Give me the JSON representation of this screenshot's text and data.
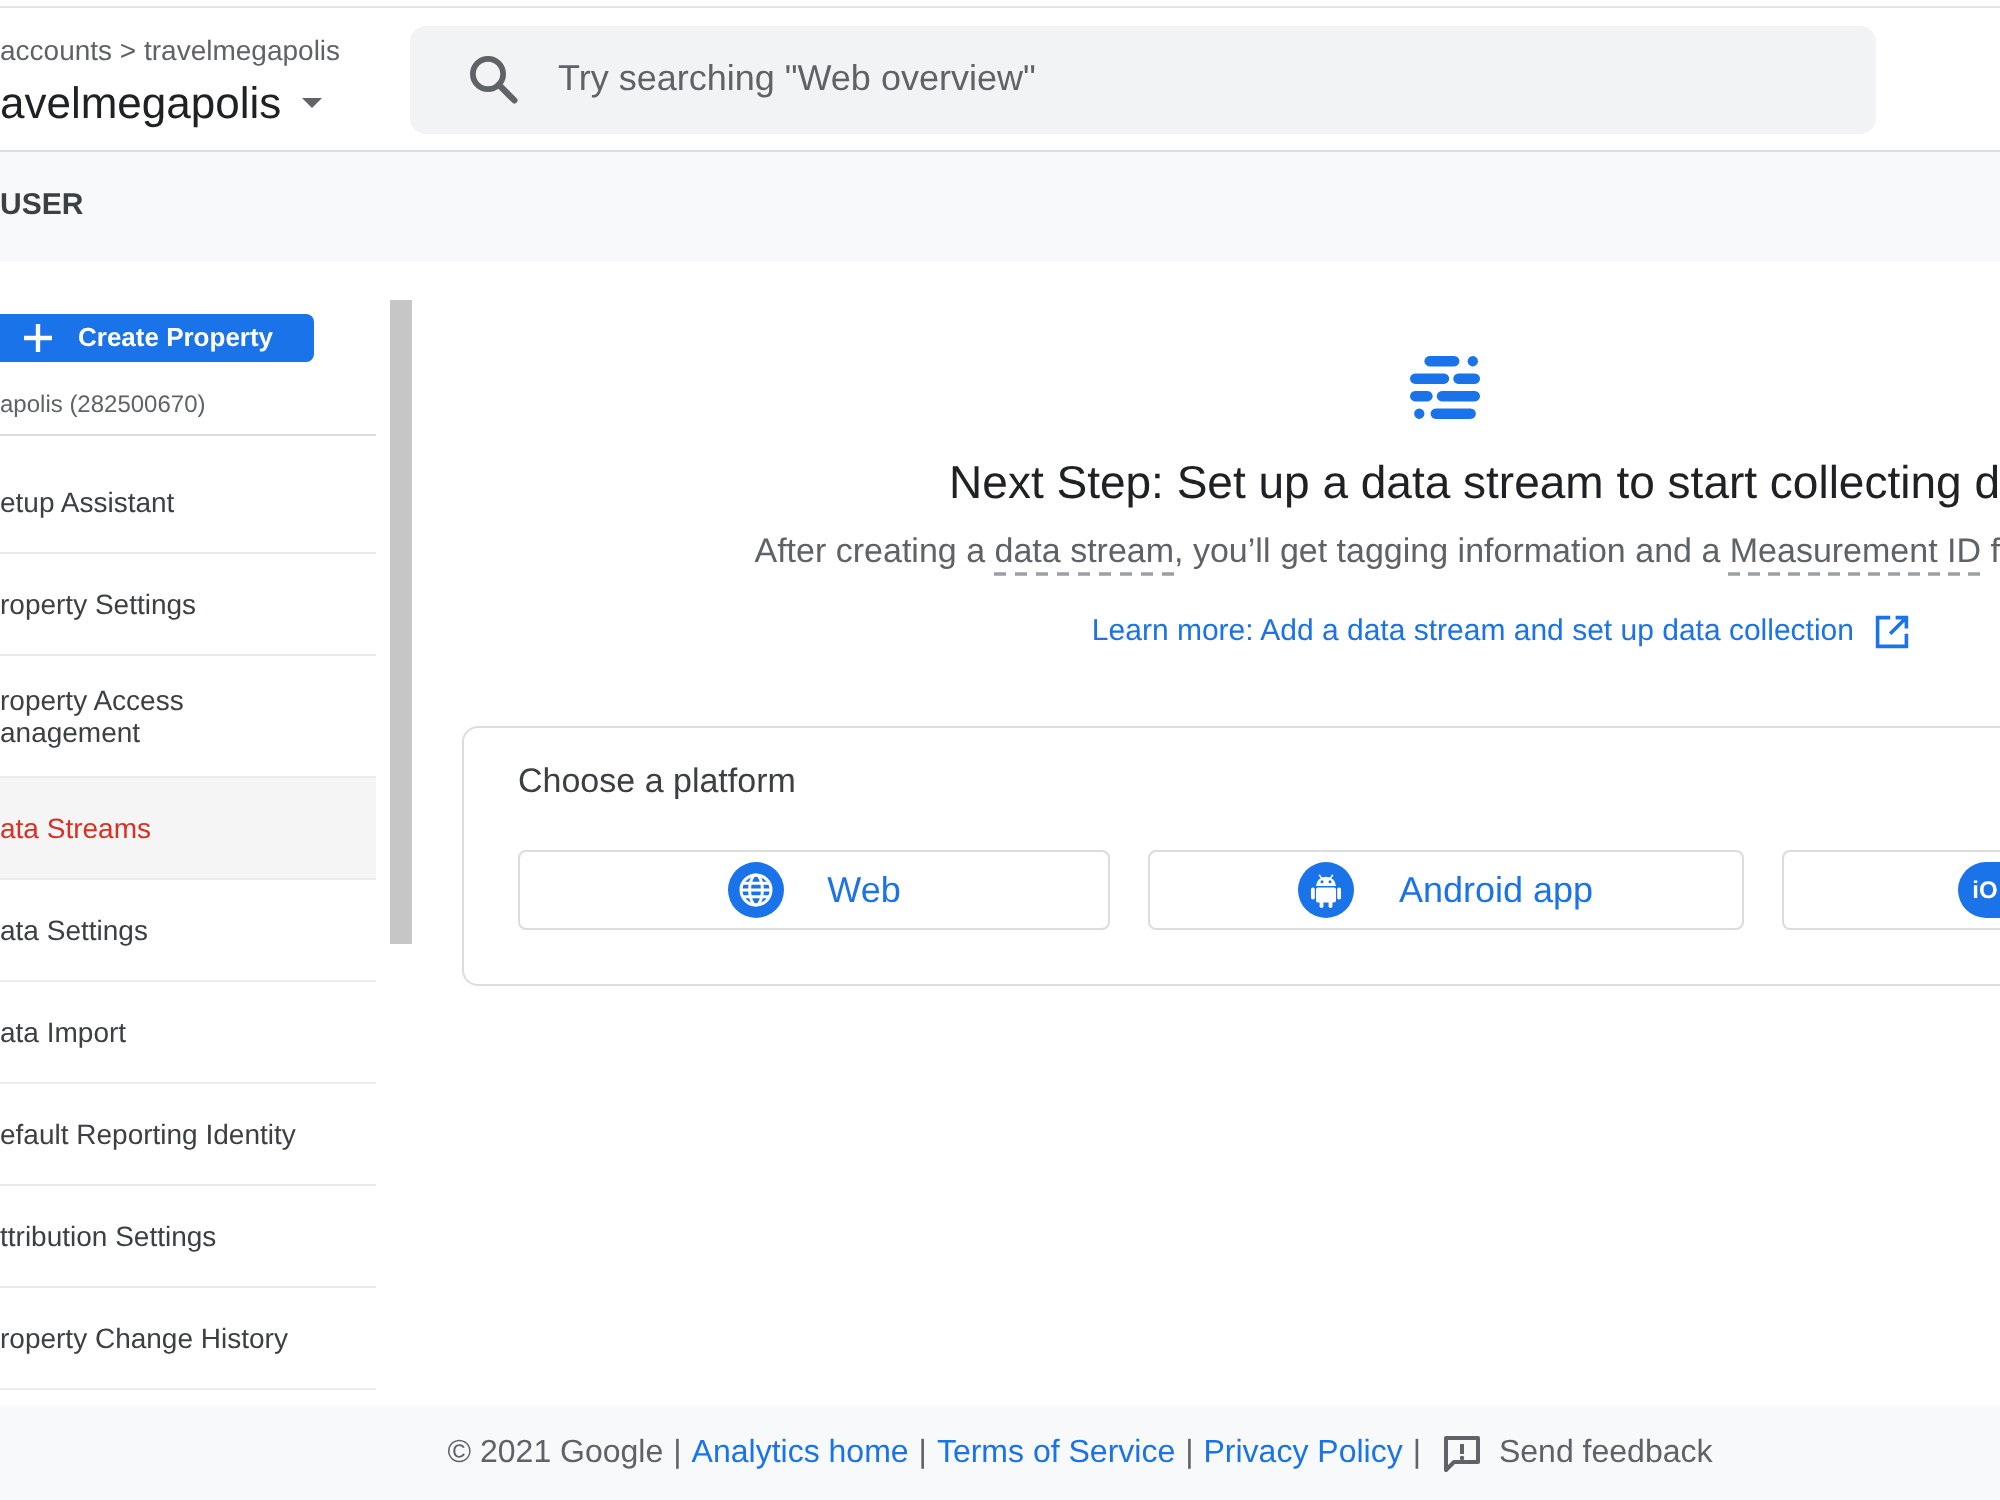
{
  "header": {
    "breadcrumb": "accounts > travelmegapolis",
    "title": "avelmegapolis",
    "search": {
      "placeholder": "Try searching \"Web overview\""
    }
  },
  "section_bar": {
    "label": "USER"
  },
  "sidebar": {
    "create_button": "Create Property",
    "property": "apolis (282500670)",
    "items": [
      {
        "label": "etup Assistant",
        "selected": false
      },
      {
        "label": "roperty Settings",
        "selected": false
      },
      {
        "label": "roperty Access\nanagement",
        "selected": false
      },
      {
        "label": "ata Streams",
        "selected": true
      },
      {
        "label": "ata Settings",
        "selected": false
      },
      {
        "label": "ata Import",
        "selected": false
      },
      {
        "label": "efault Reporting Identity",
        "selected": false
      },
      {
        "label": "ttribution Settings",
        "selected": false
      },
      {
        "label": "roperty Change History",
        "selected": false
      }
    ]
  },
  "main": {
    "heading": "Next Step: Set up a data stream to start collecting d",
    "description": [
      {
        "kind": "text",
        "text": "After creating a "
      },
      {
        "kind": "term",
        "text": "data stream"
      },
      {
        "kind": "text",
        "text": ", you’ll get tagging information and a "
      },
      {
        "kind": "term",
        "text": "Measurement ID"
      },
      {
        "kind": "text",
        "text": " f"
      }
    ],
    "learn_more": "Learn more: Add a data stream and set up data collection",
    "platform_card": {
      "title": "Choose a platform",
      "platforms": [
        {
          "kind": "web",
          "label": "Web"
        },
        {
          "kind": "android",
          "label": "Android app"
        },
        {
          "kind": "ios",
          "logo_text": "iO"
        }
      ]
    }
  },
  "footer": {
    "items": [
      {
        "kind": "text",
        "text": "© 2021 Google"
      },
      {
        "kind": "separator",
        "text": "|"
      },
      {
        "kind": "link",
        "text": "Analytics home"
      },
      {
        "kind": "separator",
        "text": "|"
      },
      {
        "kind": "link",
        "text": "Terms of Service"
      },
      {
        "kind": "separator",
        "text": "|"
      },
      {
        "kind": "link",
        "text": "Privacy Policy"
      },
      {
        "kind": "separator",
        "text": "|"
      },
      {
        "kind": "feedback",
        "text": "Send feedback"
      }
    ]
  }
}
